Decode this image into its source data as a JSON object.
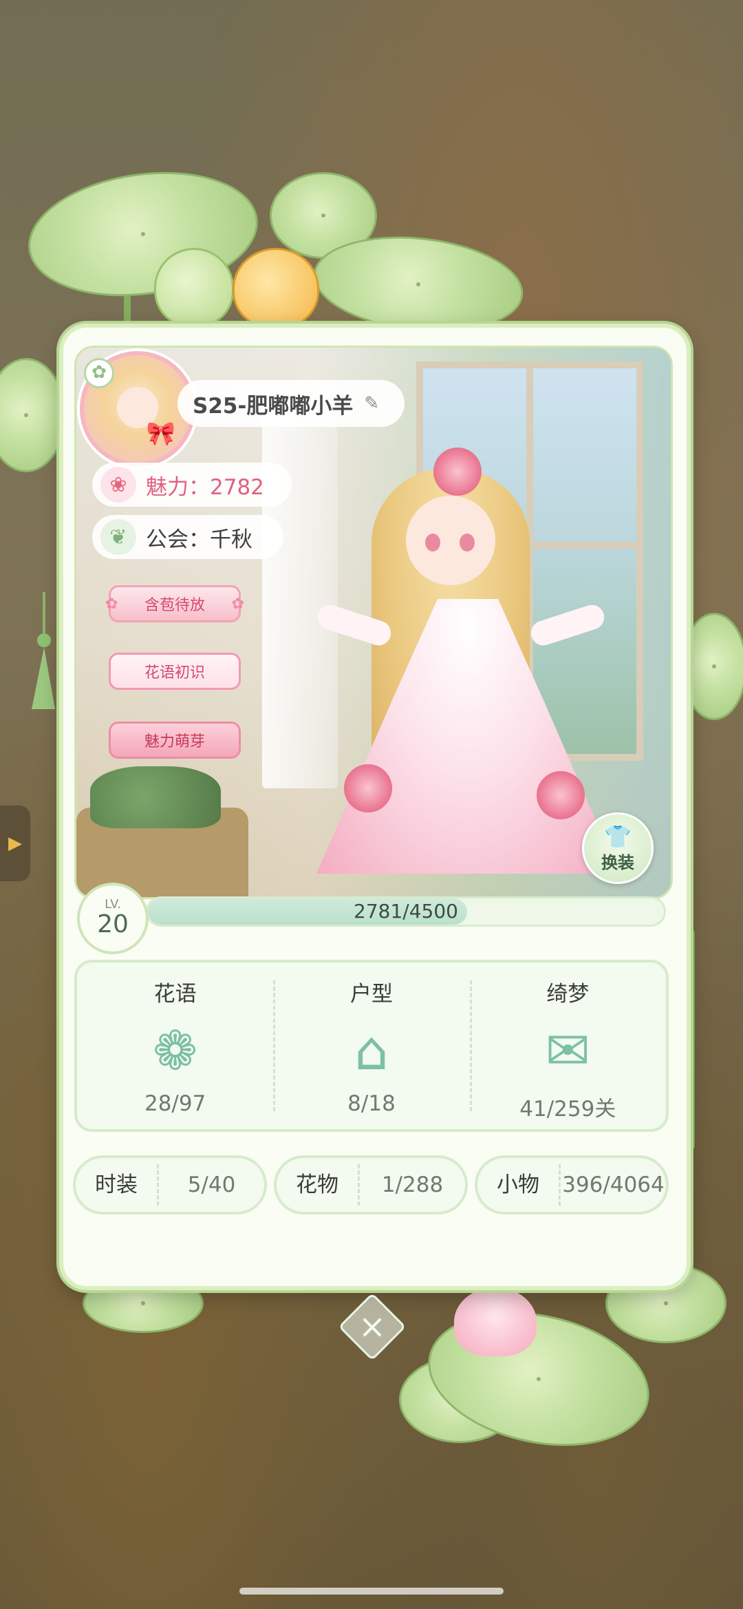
{
  "profile": {
    "name": "S25-肥嘟嘟小羊",
    "charm_label": "魅力：2782",
    "guild_label": "公会：千秋"
  },
  "badges": [
    "含苞待放",
    "花语初识",
    "魅力萌芽"
  ],
  "outfit_button": "换装",
  "level": {
    "label": "LV.",
    "value": "20",
    "xp_text": "2781/4500",
    "xp_fraction": 0.618
  },
  "collection": [
    {
      "title": "花语",
      "value": "28/97",
      "icon": "flower-icon"
    },
    {
      "title": "户型",
      "value": "8/18",
      "icon": "house-icon"
    },
    {
      "title": "绮梦",
      "value": "41/259关",
      "icon": "dream-letter-icon"
    }
  ],
  "items": [
    {
      "label": "时装",
      "value": "5/40"
    },
    {
      "label": "花物",
      "value": "1/288"
    },
    {
      "label": "小物",
      "value": "396/4064"
    }
  ],
  "colors": {
    "accent_green": "#7cc0a5",
    "charm_pink": "#e0617f",
    "card_bg": "#fafdf4"
  }
}
